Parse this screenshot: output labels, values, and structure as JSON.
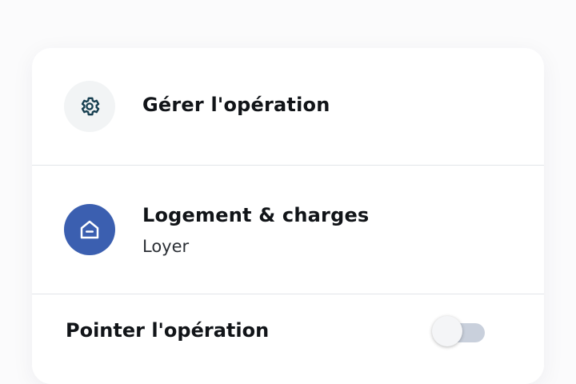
{
  "manage": {
    "label": "Gérer l'opération",
    "icon": "gear-icon",
    "icon_color": "#163e4f"
  },
  "category": {
    "title": "Logement & charges",
    "subtitle": "Loyer",
    "icon": "house-icon",
    "accent": "#3b5fb0"
  },
  "check": {
    "label": "Pointer l'opération",
    "toggle_on": false
  }
}
